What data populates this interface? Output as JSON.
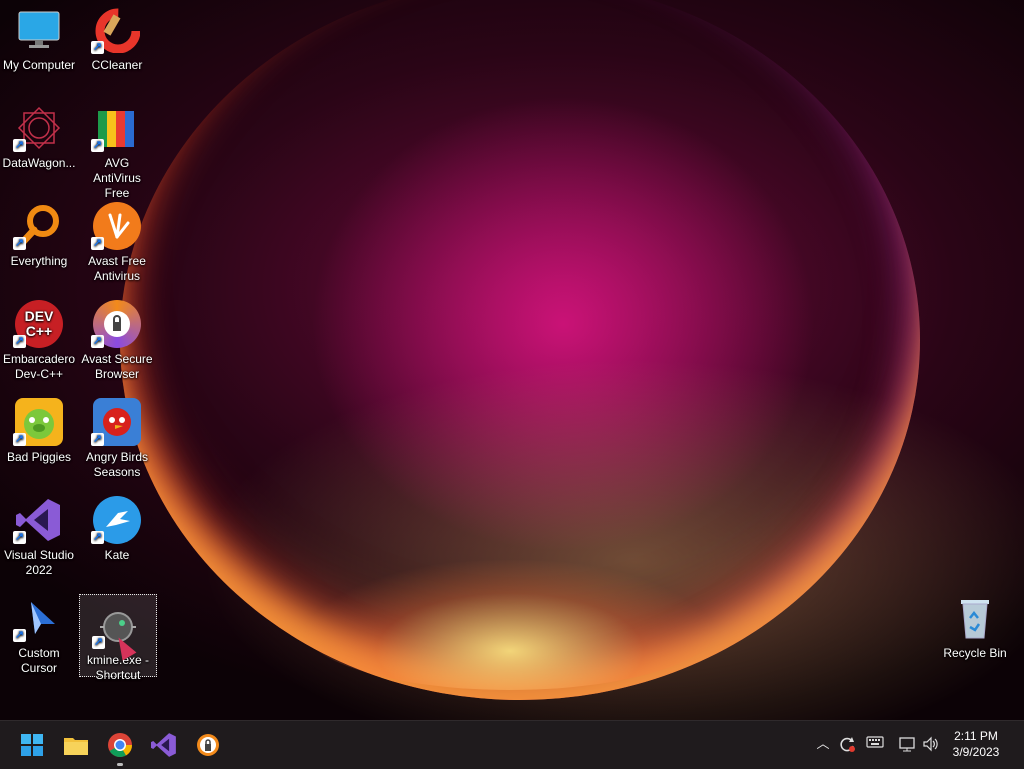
{
  "desktop": {
    "icons": [
      {
        "label": "My Computer",
        "icon": "monitor-icon"
      },
      {
        "label": "CCleaner",
        "icon": "ccleaner-icon"
      },
      {
        "label": "DataWagon...",
        "icon": "datawagon-icon"
      },
      {
        "label": "AVG AntiVirus Free",
        "icon": "avg-icon"
      },
      {
        "label": "Everything",
        "icon": "magnifier-icon"
      },
      {
        "label": "Avast Free Antivirus",
        "icon": "avast-icon"
      },
      {
        "label": "Embarcadero Dev-C++",
        "icon": "devcpp-icon"
      },
      {
        "label": "Avast Secure Browser",
        "icon": "avast-browser-icon"
      },
      {
        "label": "Bad Piggies",
        "icon": "bad-piggies-icon"
      },
      {
        "label": "Angry Birds Seasons",
        "icon": "angry-birds-icon"
      },
      {
        "label": "Visual Studio 2022",
        "icon": "visual-studio-icon"
      },
      {
        "label": "Kate",
        "icon": "kate-icon"
      },
      {
        "label": "Custom Cursor",
        "icon": "custom-cursor-icon"
      },
      {
        "label": "kmine.exe - Shortcut",
        "icon": "kmine-icon"
      },
      {
        "label": "Recycle Bin",
        "icon": "recycle-bin-icon"
      }
    ],
    "devcpp_text": "DEV C++"
  },
  "taskbar": {
    "pinned": [
      "start-icon",
      "file-explorer-icon",
      "chrome-icon",
      "visual-studio-icon",
      "avast-browser-icon"
    ],
    "tray": [
      "chevron-up-icon",
      "sync-icon",
      "keyboard-icon",
      "network-icon",
      "volume-icon"
    ],
    "time": "2:11 PM",
    "date": "3/9/2023"
  },
  "colors": {
    "taskbar_bg": "#1f1b1d",
    "accent_blue": "#1a73e8"
  }
}
